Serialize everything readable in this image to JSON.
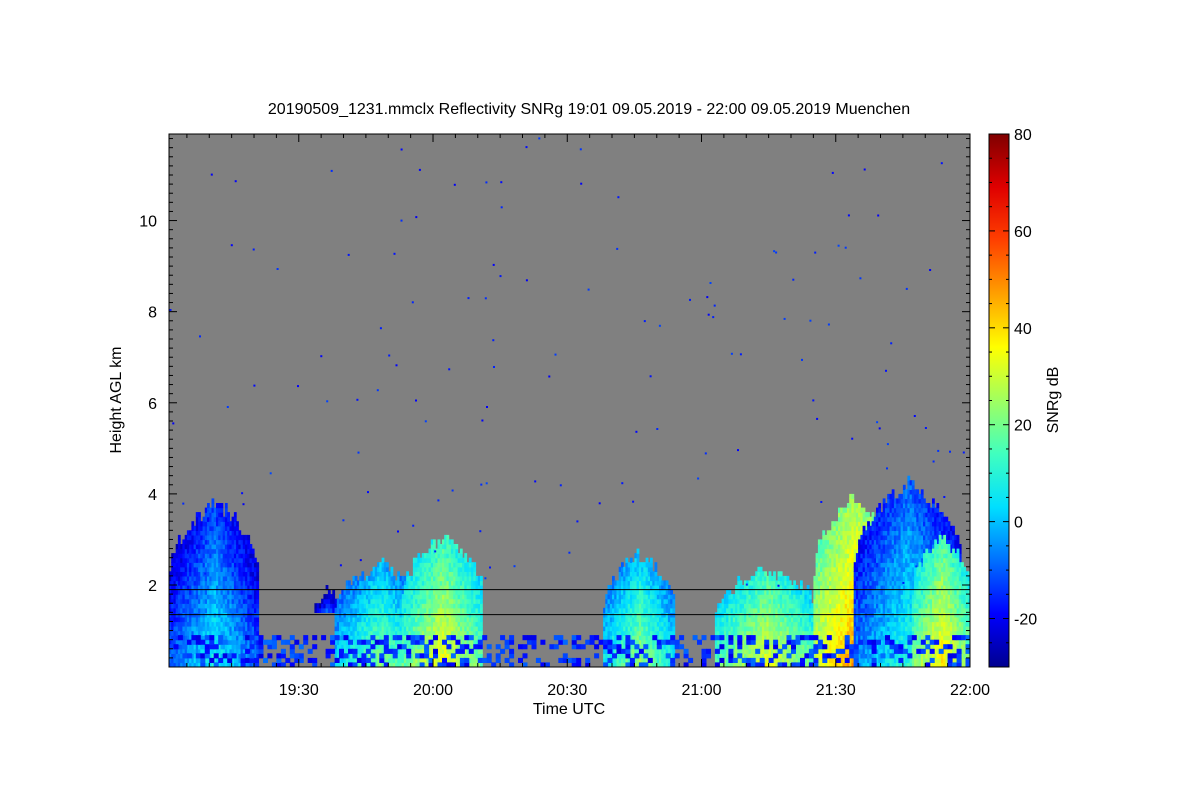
{
  "chart_data": {
    "type": "heatmap",
    "title": "20190509_1231.mmclx Reflectivity SNRg   19:01 09.05.2019 - 22:00 09.05.2019 Muenchen",
    "xlabel": "Time UTC",
    "ylabel": "Height AGL km",
    "colorbar_label": "SNRg dB",
    "x_range_minutes": [
      1141,
      1320
    ],
    "y_range_km": [
      0.2,
      11.9
    ],
    "x_ticks": [
      {
        "value": 1170,
        "label": "19:30"
      },
      {
        "value": 1200,
        "label": "20:00"
      },
      {
        "value": 1230,
        "label": "20:30"
      },
      {
        "value": 1260,
        "label": "21:00"
      },
      {
        "value": 1290,
        "label": "21:30"
      },
      {
        "value": 1320,
        "label": "22:00"
      }
    ],
    "y_ticks": [
      {
        "value": 2,
        "label": "2"
      },
      {
        "value": 4,
        "label": "4"
      },
      {
        "value": 6,
        "label": "6"
      },
      {
        "value": 8,
        "label": "8"
      },
      {
        "value": 10,
        "label": "10"
      }
    ],
    "colorbar_range": [
      -30,
      80
    ],
    "colorbar_ticks": [
      {
        "value": -20,
        "label": "-20"
      },
      {
        "value": 0,
        "label": "0"
      },
      {
        "value": 20,
        "label": "20"
      },
      {
        "value": 40,
        "label": "40"
      },
      {
        "value": 60,
        "label": "60"
      },
      {
        "value": 80,
        "label": "80"
      }
    ],
    "colormap": [
      "#00008f",
      "#0000ff",
      "#0070ff",
      "#00dfff",
      "#40ffbf",
      "#a0ff60",
      "#ffff00",
      "#ffa000",
      "#ff4000",
      "#df0000",
      "#800000"
    ],
    "background_color": "#808080",
    "layer_lines_km": [
      1.9,
      1.35
    ],
    "cloud_features": [
      {
        "t_start": 1141,
        "t_end": 1161,
        "base_km": 0.2,
        "top_km": 3.8,
        "peak_snr": 8
      },
      {
        "t_start": 1173,
        "t_end": 1180,
        "base_km": 1.4,
        "top_km": 2.0,
        "peak_snr": -10
      },
      {
        "t_start": 1178,
        "t_end": 1198,
        "base_km": 0.2,
        "top_km": 2.4,
        "peak_snr": 22
      },
      {
        "t_start": 1193,
        "t_end": 1211,
        "base_km": 0.2,
        "top_km": 3.0,
        "peak_snr": 35
      },
      {
        "t_start": 1238,
        "t_end": 1254,
        "base_km": 0.2,
        "top_km": 2.6,
        "peak_snr": 24
      },
      {
        "t_start": 1263,
        "t_end": 1286,
        "base_km": 0.2,
        "top_km": 2.3,
        "peak_snr": 34
      },
      {
        "t_start": 1285,
        "t_end": 1303,
        "base_km": 0.2,
        "top_km": 3.9,
        "peak_snr": 48
      },
      {
        "t_start": 1294,
        "t_end": 1318,
        "base_km": 0.2,
        "top_km": 4.2,
        "peak_snr": 12
      },
      {
        "t_start": 1307,
        "t_end": 1320,
        "base_km": 0.2,
        "top_km": 3.0,
        "peak_snr": 38
      }
    ]
  }
}
